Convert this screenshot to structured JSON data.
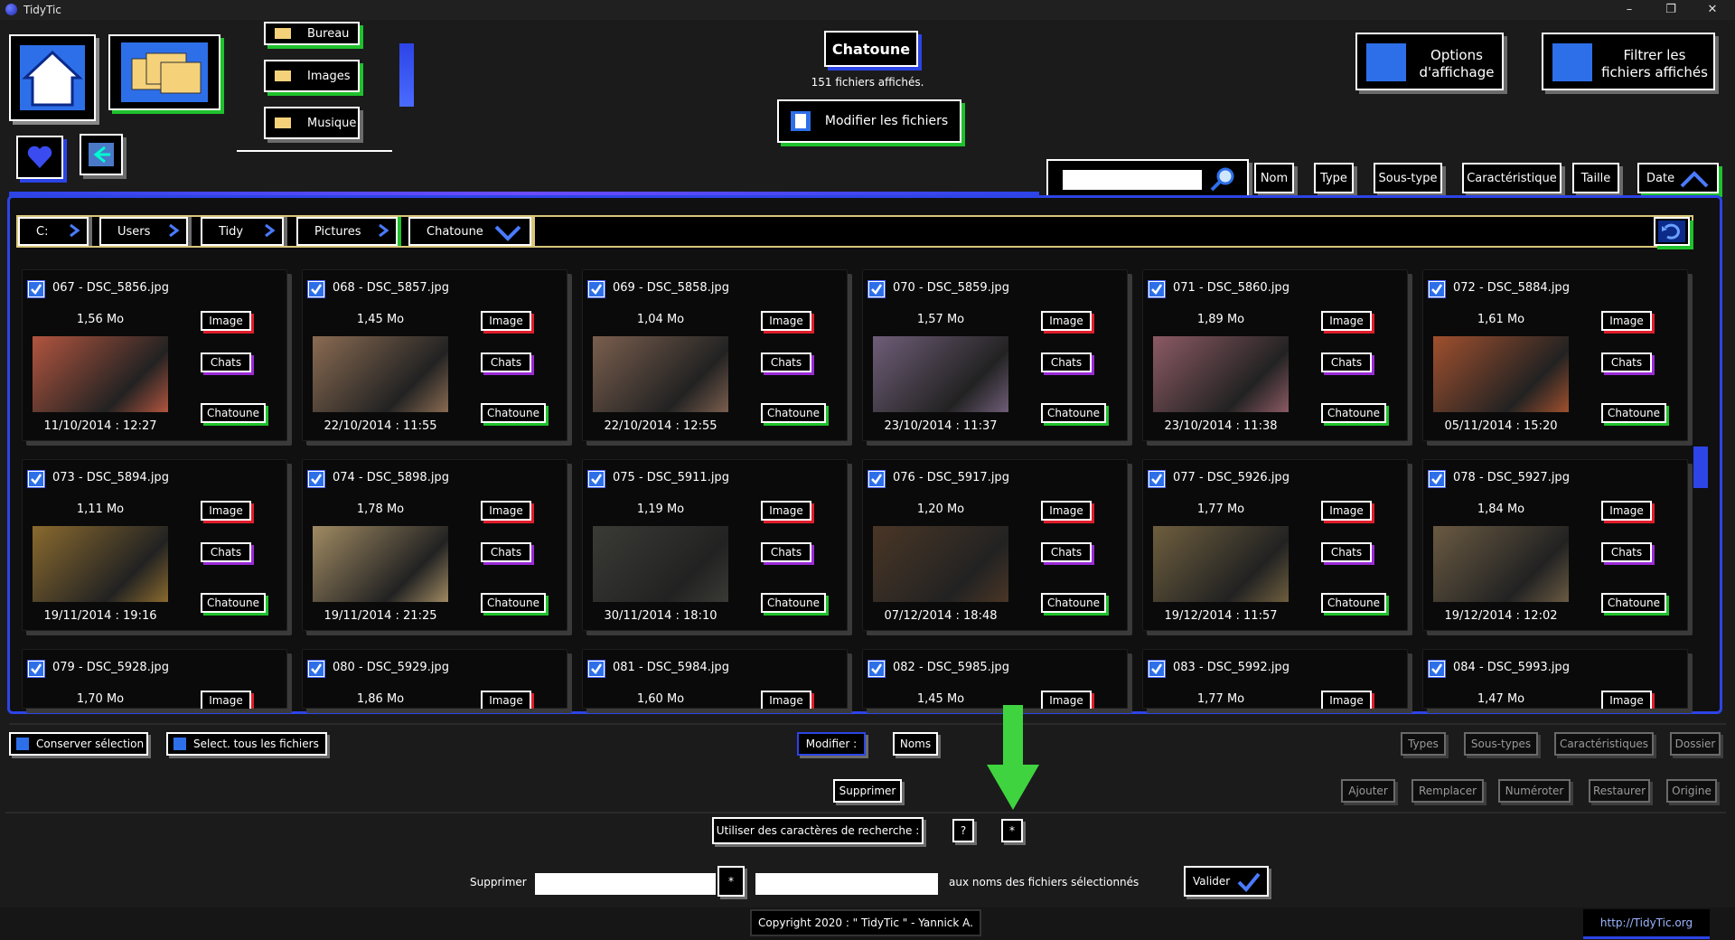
{
  "window": {
    "title": "TidyTic",
    "controls": [
      "–",
      "❐",
      "✕"
    ]
  },
  "nav": {
    "folders": [
      "Bureau",
      "Images",
      "Musique"
    ]
  },
  "header": {
    "folder_name": "Chatoune",
    "file_count": "151 fichiers affichés.",
    "modify_button": "Modifier les fichiers",
    "options_button": [
      "Options",
      "d'affichage"
    ],
    "filter_button": [
      "Filtrer les",
      "fichiers affichés"
    ]
  },
  "search": {
    "value": "",
    "placeholder": ""
  },
  "sort": {
    "buttons": [
      "Nom",
      "Type",
      "Sous-type",
      "Caractéristique",
      "Taille",
      "Date"
    ],
    "active": "Date"
  },
  "path": {
    "segments": [
      "C:",
      "Users",
      "Tidy",
      "Pictures",
      "Chatoune"
    ]
  },
  "files": [
    {
      "name": "067 - DSC_5856.jpg",
      "size": "1,56 Mo",
      "date": "11/10/2014 : 12:27",
      "type": "Image",
      "subtype": "Chats",
      "char": "Chatoune",
      "thumb": "#b2553f"
    },
    {
      "name": "068 - DSC_5857.jpg",
      "size": "1,45 Mo",
      "date": "22/10/2014 : 11:55",
      "type": "Image",
      "subtype": "Chats",
      "char": "Chatoune",
      "thumb": "#8a6b52"
    },
    {
      "name": "069 - DSC_5858.jpg",
      "size": "1,04 Mo",
      "date": "22/10/2014 : 12:55",
      "type": "Image",
      "subtype": "Chats",
      "char": "Chatoune",
      "thumb": "#7a5e4e"
    },
    {
      "name": "070 - DSC_5859.jpg",
      "size": "1,57 Mo",
      "date": "23/10/2014 : 11:37",
      "type": "Image",
      "subtype": "Chats",
      "char": "Chatoune",
      "thumb": "#6f5d78"
    },
    {
      "name": "071 - DSC_5860.jpg",
      "size": "1,89 Mo",
      "date": "23/10/2014 : 11:38",
      "type": "Image",
      "subtype": "Chats",
      "char": "Chatoune",
      "thumb": "#8c5a64"
    },
    {
      "name": "072 - DSC_5884.jpg",
      "size": "1,61 Mo",
      "date": "05/11/2014 : 15:20",
      "type": "Image",
      "subtype": "Chats",
      "char": "Chatoune",
      "thumb": "#a0502e"
    },
    {
      "name": "073 - DSC_5894.jpg",
      "size": "1,11 Mo",
      "date": "19/11/2014 : 19:16",
      "type": "Image",
      "subtype": "Chats",
      "char": "Chatoune",
      "thumb": "#8a6a2e"
    },
    {
      "name": "074 - DSC_5898.jpg",
      "size": "1,78 Mo",
      "date": "19/11/2014 : 21:25",
      "type": "Image",
      "subtype": "Chats",
      "char": "Chatoune",
      "thumb": "#a08a62"
    },
    {
      "name": "075 - DSC_5911.jpg",
      "size": "1,19 Mo",
      "date": "30/11/2014 : 18:10",
      "type": "Image",
      "subtype": "Chats",
      "char": "Chatoune",
      "thumb": "#3a3a36"
    },
    {
      "name": "076 - DSC_5917.jpg",
      "size": "1,20 Mo",
      "date": "07/12/2014 : 18:48",
      "type": "Image",
      "subtype": "Chats",
      "char": "Chatoune",
      "thumb": "#4a3626"
    },
    {
      "name": "077 - DSC_5926.jpg",
      "size": "1,77 Mo",
      "date": "19/12/2014 : 11:57",
      "type": "Image",
      "subtype": "Chats",
      "char": "Chatoune",
      "thumb": "#6e5e3e"
    },
    {
      "name": "078 - DSC_5927.jpg",
      "size": "1,84 Mo",
      "date": "19/12/2014 : 12:02",
      "type": "Image",
      "subtype": "Chats",
      "char": "Chatoune",
      "thumb": "#6a5a42"
    },
    {
      "name": "079 - DSC_5928.jpg",
      "size": "1,70 Mo",
      "date": "",
      "type": "Image",
      "subtype": "",
      "char": "",
      "thumb": ""
    },
    {
      "name": "080 - DSC_5929.jpg",
      "size": "1,86 Mo",
      "date": "",
      "type": "Image",
      "subtype": "",
      "char": "",
      "thumb": ""
    },
    {
      "name": "081 - DSC_5984.jpg",
      "size": "1,60 Mo",
      "date": "",
      "type": "Image",
      "subtype": "",
      "char": "",
      "thumb": ""
    },
    {
      "name": "082 - DSC_5985.jpg",
      "size": "1,45 Mo",
      "date": "",
      "type": "Image",
      "subtype": "",
      "char": "",
      "thumb": ""
    },
    {
      "name": "083 - DSC_5992.jpg",
      "size": "1,77 Mo",
      "date": "",
      "type": "Image",
      "subtype": "",
      "char": "",
      "thumb": ""
    },
    {
      "name": "084 - DSC_5993.jpg",
      "size": "1,47 Mo",
      "date": "",
      "type": "Image",
      "subtype": "",
      "char": "",
      "thumb": ""
    }
  ],
  "bottom": {
    "keep_selection": "Conserver sélection",
    "select_all": "Select. tous les fichiers",
    "modify_label": "Modifier :",
    "names": "Noms",
    "types": "Types",
    "subtypes": "Sous-types",
    "characteristics": "Caractéristiques",
    "folder": "Dossier",
    "delete": "Supprimer",
    "add": "Ajouter",
    "replace": "Remplacer",
    "number": "Numéroter",
    "restore": "Restaurer",
    "origin": "Origine",
    "wildcards_label": "Utiliser des caractères de recherche :",
    "wild_q": "?",
    "wild_star": "*",
    "remove_label": "Supprimer",
    "remove_value_1": "",
    "remove_star": "*",
    "remove_value_2": "",
    "remove_suffix": "aux noms des fichiers sélectionnés",
    "validate": "Valider"
  },
  "footer": {
    "copyright": "Copyright 2020 : \" TidyTic \" - Yannick A.",
    "link": "http://TidyTic.org"
  },
  "colors": {
    "accent_blue": "#2d44e6",
    "accent_green": "#1fc12c",
    "type_red": "#e01e2b",
    "subtype_purple": "#9b2bd6",
    "arrow_green": "#3fd43f"
  }
}
